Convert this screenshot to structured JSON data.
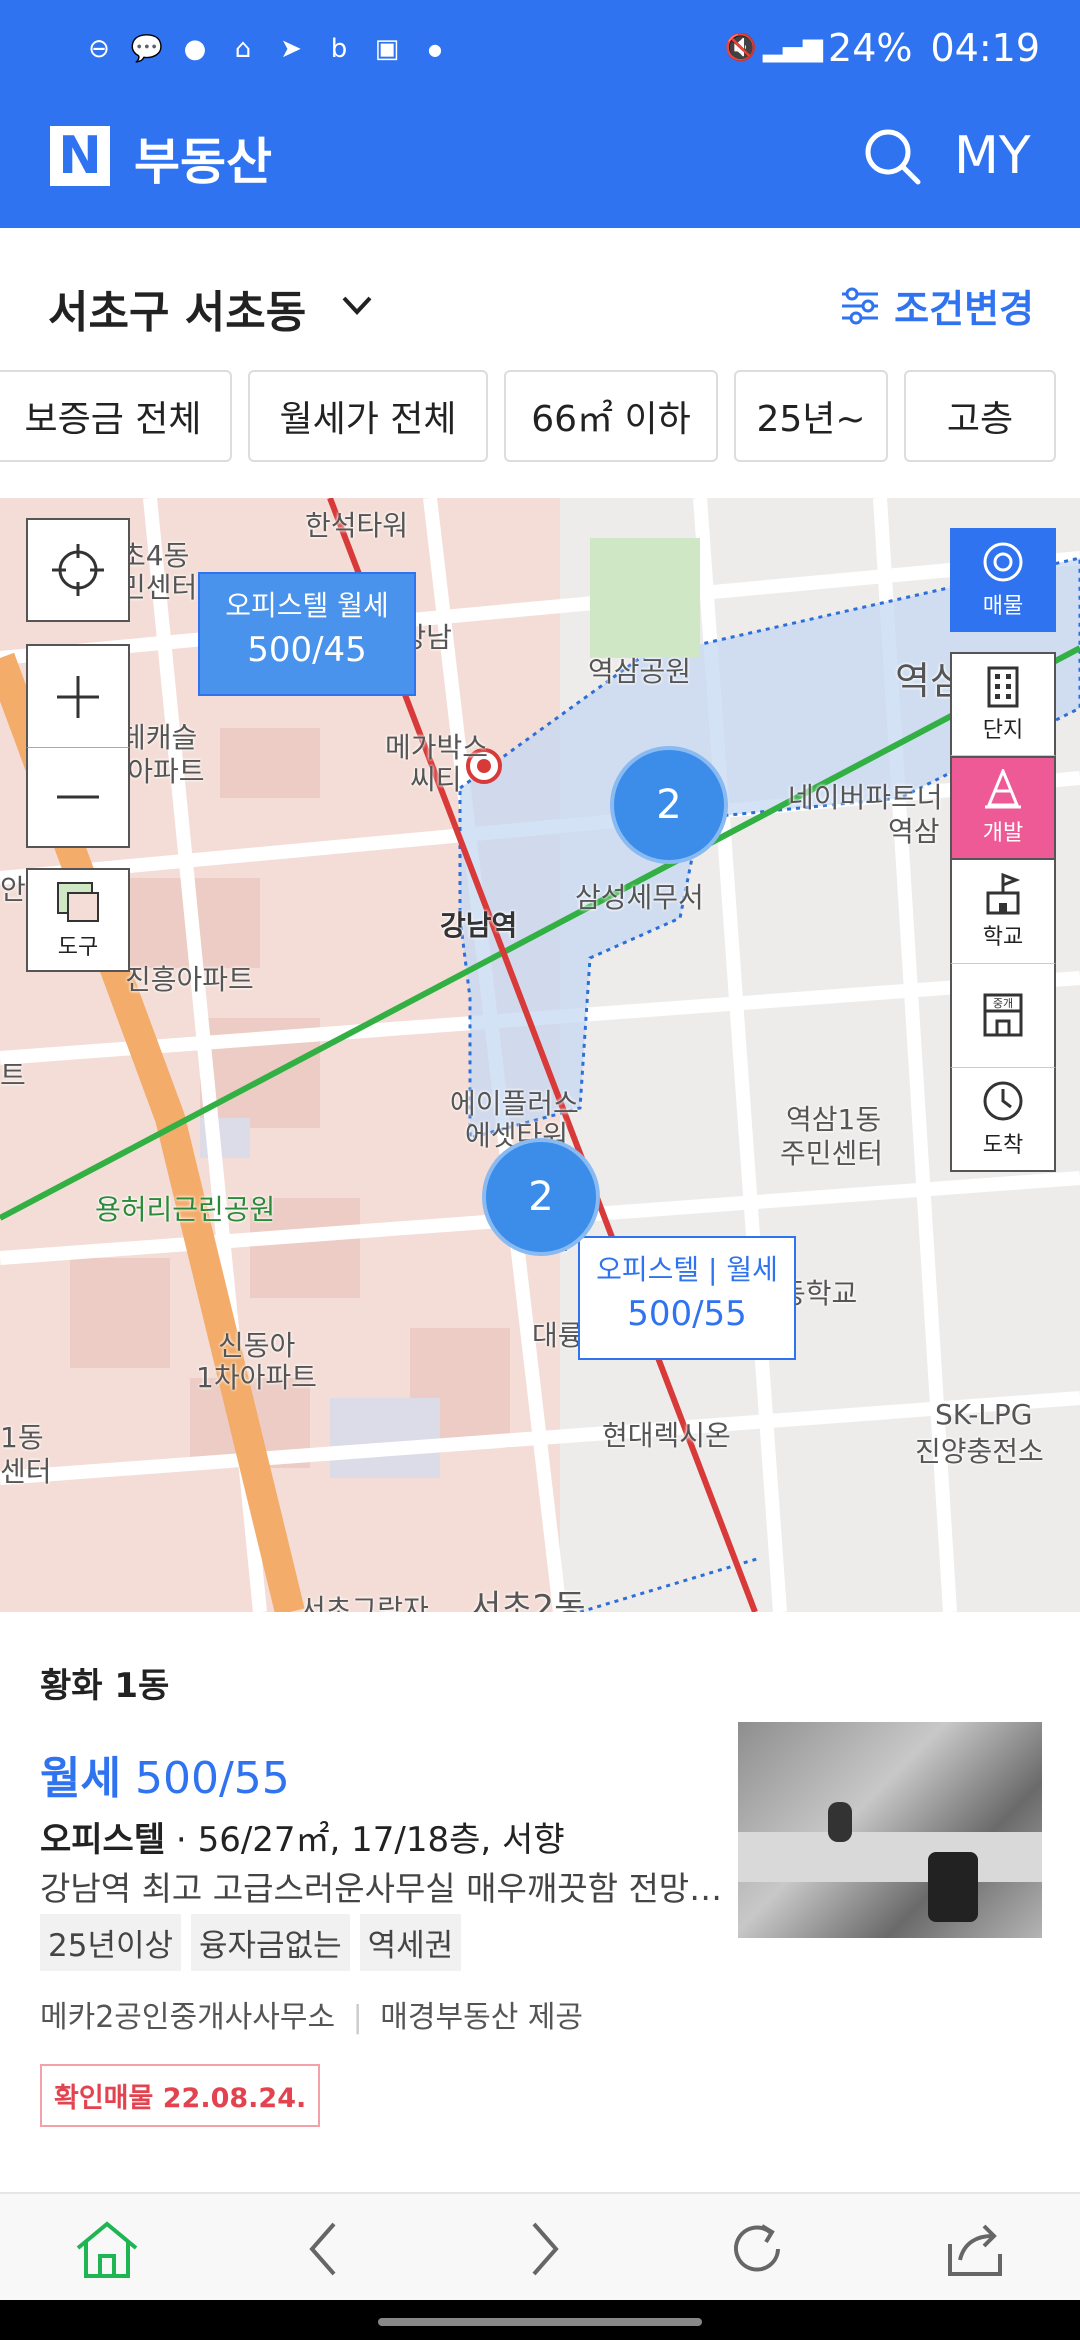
{
  "status": {
    "battery": "24%",
    "time": "04:19"
  },
  "app": {
    "title": "부동산",
    "my_label": "MY"
  },
  "location": {
    "title": "서초구 서초동",
    "cond_button": "조건변경"
  },
  "filters": [
    "보증금 전체",
    "월세가 전체",
    "66㎡ 이하",
    "25년~",
    "고층"
  ],
  "map": {
    "tool_label": "도구",
    "right_buttons": [
      "매물",
      "단지",
      "개발",
      "학교",
      "중개",
      "도착"
    ],
    "bubble1": {
      "title": "오피스텔  월세",
      "price": "500/45"
    },
    "bubble2": {
      "title": "오피스텔 | 월세",
      "price": "500/55"
    },
    "cluster1": "2",
    "cluster2": "2",
    "labels": [
      "한석타워",
      "초4동",
      "민센터",
      "CGV강남",
      "역삼공원",
      "역삼",
      "데캐슬",
      "래미안아파트",
      "메가박스",
      "씨티",
      "네이버파트너",
      "역삼",
      "삼성세무서",
      "강남역",
      "진흥아파트",
      "에이플러스",
      "에셋타워",
      "역삼1동",
      "주민센터",
      "용허리근린공원",
      "우남",
      "동학교",
      "대륭서초타워",
      "신동아",
      "1차아파트",
      "현대렉시온",
      "SK-LPG",
      "진양충전소",
      "1동",
      "센터",
      "서초그랑자",
      "서초2동",
      "안",
      "트"
    ]
  },
  "listing": {
    "area": "황화 1동",
    "type": "월세",
    "price": "500/55",
    "spec_type": "오피스텔",
    "spec_rest": "56/27㎡, 17/18층, 서향",
    "desc": "강남역 최고 고급스러운사무실 매우깨끗함 전망…",
    "tags": [
      "25년이상",
      "융자금없는",
      "역세권"
    ],
    "agent": "메카2공인중개사사무소",
    "provider": "매경부동산 제공",
    "confirm": "확인매물 22.08.24."
  },
  "colors": {
    "brand": "#2f73f0",
    "pink": "#ee5a95",
    "green": "#1fb553"
  }
}
